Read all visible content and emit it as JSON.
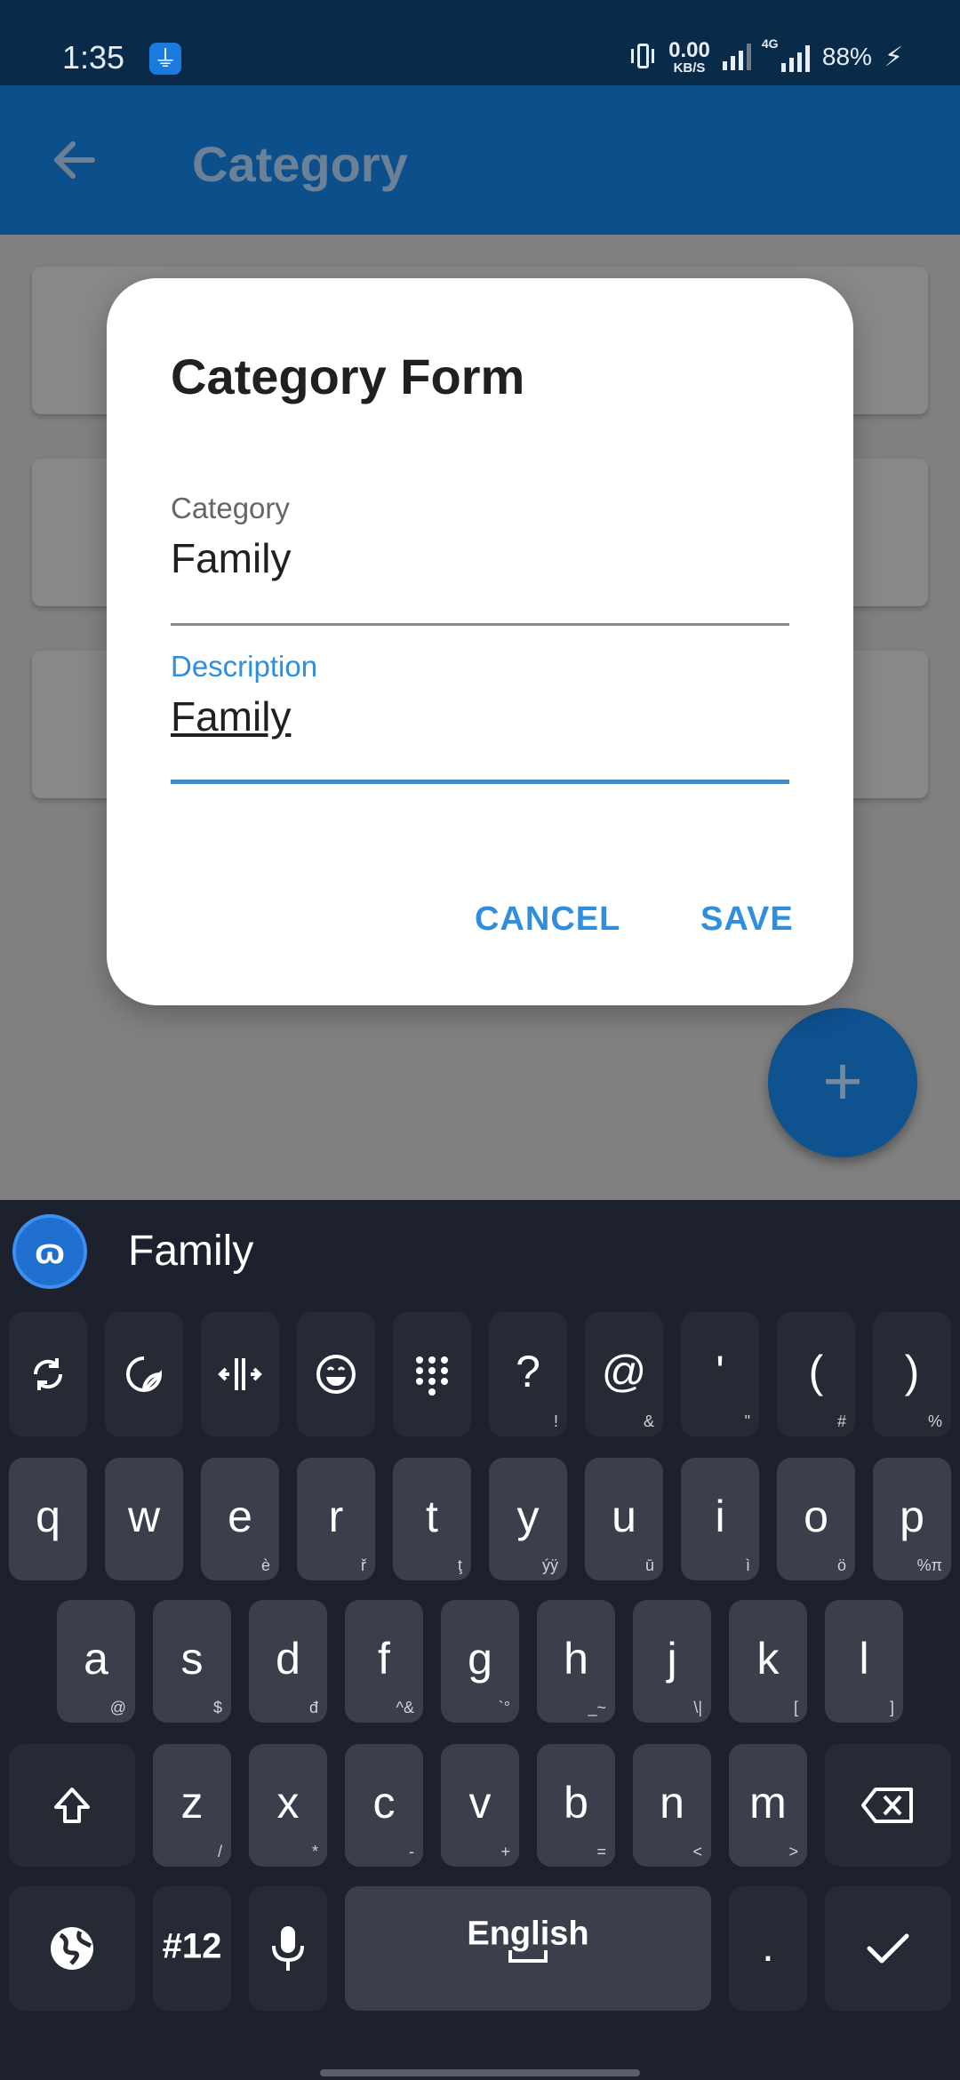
{
  "status_bar": {
    "time": "1:35",
    "net_speed_value": "0.00",
    "net_speed_unit": "KB/S",
    "network_type": "4G",
    "battery": "88%"
  },
  "app_bar": {
    "title": "Category"
  },
  "dialog": {
    "title": "Category Form",
    "category_label": "Category",
    "category_value": "Family",
    "description_label": "Description",
    "description_value": "Family",
    "cancel_label": "CANCEL",
    "save_label": "SAVE"
  },
  "fab": {
    "symbol": "+"
  },
  "keyboard": {
    "suggestion": "Family",
    "tool_row": [
      {
        "main": "",
        "sub": "",
        "name": "rotate-icon"
      },
      {
        "main": "",
        "sub": "",
        "name": "sticker-icon"
      },
      {
        "main": "",
        "sub": "",
        "name": "cursor-move-icon"
      },
      {
        "main": "",
        "sub": "",
        "name": "emoji-icon"
      },
      {
        "main": "",
        "sub": "",
        "name": "numpad-icon"
      },
      {
        "main": "?",
        "sub": "!",
        "name": "key-question"
      },
      {
        "main": "@",
        "sub": "&",
        "name": "key-at"
      },
      {
        "main": "'",
        "sub": "\"",
        "name": "key-apostrophe"
      },
      {
        "main": "(",
        "sub": "#",
        "name": "key-open-paren"
      },
      {
        "main": ")",
        "sub": "%",
        "name": "key-close-paren"
      }
    ],
    "row1": [
      {
        "main": "q",
        "sub": ""
      },
      {
        "main": "w",
        "sub": ""
      },
      {
        "main": "e",
        "sub": "è"
      },
      {
        "main": "r",
        "sub": "ř"
      },
      {
        "main": "t",
        "sub": "ţ"
      },
      {
        "main": "y",
        "sub": "ýÿ"
      },
      {
        "main": "u",
        "sub": "ū"
      },
      {
        "main": "i",
        "sub": "ì"
      },
      {
        "main": "o",
        "sub": "ö"
      },
      {
        "main": "p",
        "sub": "%π"
      }
    ],
    "row2": [
      {
        "main": "a",
        "sub": "@"
      },
      {
        "main": "s",
        "sub": "$"
      },
      {
        "main": "d",
        "sub": "đ"
      },
      {
        "main": "f",
        "sub": "^&"
      },
      {
        "main": "g",
        "sub": "`°"
      },
      {
        "main": "h",
        "sub": "_~"
      },
      {
        "main": "j",
        "sub": "\\|"
      },
      {
        "main": "k",
        "sub": "["
      },
      {
        "main": "l",
        "sub": "]"
      }
    ],
    "row3": [
      {
        "main": "z",
        "sub": "/"
      },
      {
        "main": "x",
        "sub": "*"
      },
      {
        "main": "c",
        "sub": "-"
      },
      {
        "main": "v",
        "sub": "+"
      },
      {
        "main": "b",
        "sub": "="
      },
      {
        "main": "n",
        "sub": "<"
      },
      {
        "main": "m",
        "sub": ">"
      }
    ],
    "num_label": "#12",
    "space_label": "English",
    "period_label": "."
  }
}
